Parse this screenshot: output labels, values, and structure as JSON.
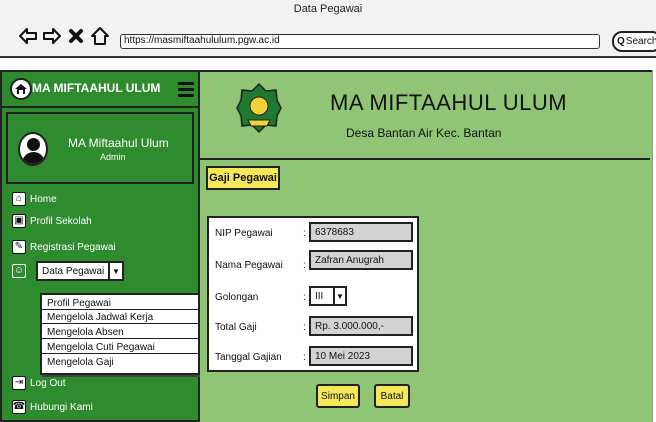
{
  "window": {
    "title": "Data Pegawai"
  },
  "browser": {
    "url": "https://masmiftaahululum.pgw.ac.id",
    "search_label": "Search",
    "search_glyph": "Q"
  },
  "sidebar": {
    "brand": "MA MIFTAAHUL ULUM",
    "profile": {
      "name": "MA Miftaahul Ulum",
      "role": "Admin"
    },
    "menu": {
      "home": "Home",
      "profil_sekolah": "Profil Sekolah",
      "registrasi_pegawai": "Registrasi Pegawai",
      "data_pegawai": "Data Pegawai",
      "log_out": "Log Out",
      "hubungi_kami": "Hubungi Kami"
    },
    "dropdown_options": [
      "Profil Pegawai",
      "Mengelola Jadwal Kerja",
      "Mengelola Absen",
      "Mengelola Cuti Pegawai",
      "Mengelola Gaji"
    ]
  },
  "main": {
    "title": "MA MIFTAAHUL ULUM",
    "subtitle": "Desa Bantan Air Kec. Bantan",
    "section_label": "Gaji Pegawai",
    "form": {
      "nip_label": "NIP Pegawai",
      "nip_value": "6378683",
      "nama_label": "Nama Pegawai",
      "nama_value": "Zafran Anugrah",
      "golongan_label": "Golongan",
      "golongan_value": "III",
      "total_label": "Total Gaji",
      "total_value": "Rp. 3.000.000,-",
      "tanggal_label": "Tanggal Gajian",
      "tanggal_value": "10 Mei 2023",
      "colon": ":"
    },
    "buttons": {
      "save": "Simpan",
      "cancel": "Batal"
    }
  },
  "colors": {
    "sidebar_bg": "#2e8b2e",
    "main_bg": "#8fc574",
    "accent_yellow": "#f5e75a",
    "input_gray": "#d3d3d3"
  },
  "icons": {
    "back": "arrow-left-icon",
    "forward": "arrow-right-icon",
    "close": "close-icon",
    "home": "home-icon",
    "search": "search-icon",
    "menu": "hamburger-icon"
  }
}
